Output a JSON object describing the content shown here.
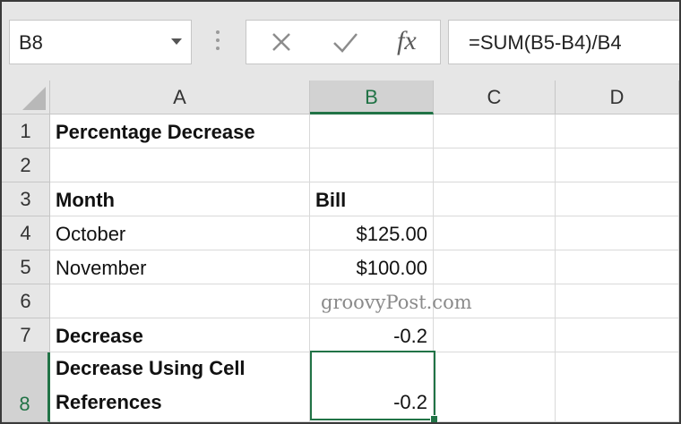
{
  "name_box": "B8",
  "formula": "=SUM(B5-B4)/B4",
  "fx_label": "fx",
  "columns": [
    "A",
    "B",
    "C",
    "D"
  ],
  "rows": [
    "1",
    "2",
    "3",
    "4",
    "5",
    "6",
    "7",
    "8"
  ],
  "cells": {
    "A1": "Percentage Decrease",
    "A3": "Month",
    "B3": "Bill",
    "A4": "October",
    "B4": "$125.00",
    "A5": "November",
    "B5": "$100.00",
    "A7": "Decrease",
    "B7": "-0.2",
    "A8_line1": "Decrease Using Cell",
    "A8_line2": "References",
    "B8": "-0.2"
  },
  "watermark": "groovyPost.com",
  "colors": {
    "accent": "#217346",
    "header_bg": "#e6e6e6"
  }
}
